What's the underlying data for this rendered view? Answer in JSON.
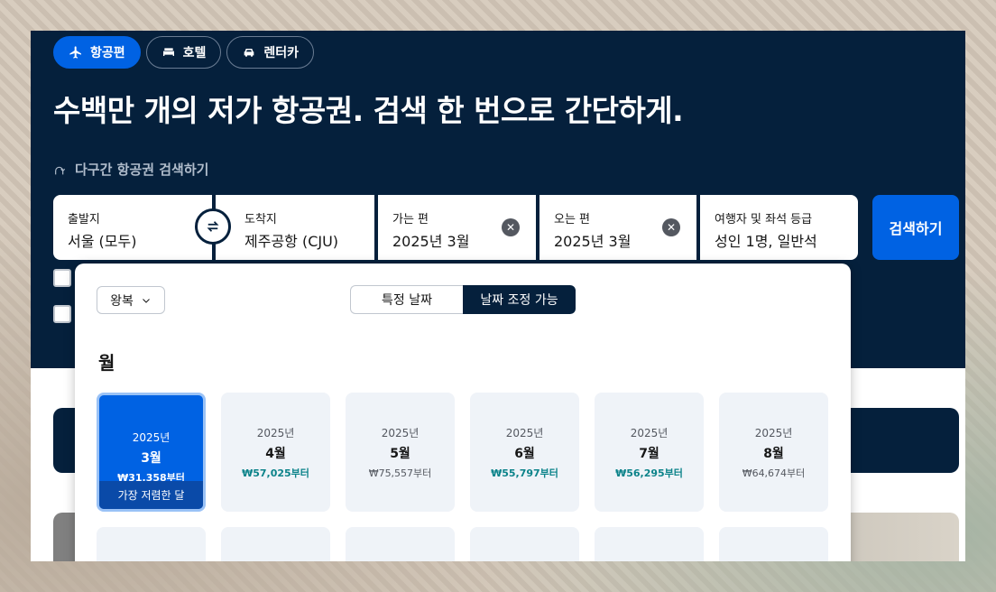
{
  "tabs": [
    {
      "label": "항공편",
      "icon": "plane-icon",
      "active": true
    },
    {
      "label": "호텔",
      "icon": "bed-icon",
      "active": false
    },
    {
      "label": "렌터카",
      "icon": "car-icon",
      "active": false
    }
  ],
  "headline": "수백만 개의 저가 항공권. 검색 한 번으로 간단하게.",
  "multi_city_link": "다구간 항공권 검색하기",
  "search": {
    "origin": {
      "label": "출발지",
      "value": "서울 (모두)"
    },
    "destination": {
      "label": "도착지",
      "value": "제주공항 (CJU)"
    },
    "depart": {
      "label": "가는 편",
      "value": "2025년 3월"
    },
    "return": {
      "label": "오는 편",
      "value": "2025년 3월"
    },
    "travellers": {
      "label": "여행자 및 좌석 등급",
      "value": "성인 1명, 일반석"
    },
    "search_button": "검색하기"
  },
  "calendar_popup": {
    "trip_type": "왕복",
    "date_mode": [
      "특정 날짜",
      "날짜 조정 가능"
    ],
    "section_title": "월",
    "months": [
      {
        "year": "2025년",
        "month": "3월",
        "price": "₩31,358부터",
        "cheap": true,
        "selected": true,
        "badge": "가장 저렴한 달"
      },
      {
        "year": "2025년",
        "month": "4월",
        "price": "₩57,025부터",
        "cheap": true,
        "selected": false
      },
      {
        "year": "2025년",
        "month": "5월",
        "price": "₩75,557부터",
        "cheap": false,
        "selected": false
      },
      {
        "year": "2025년",
        "month": "6월",
        "price": "₩55,797부터",
        "cheap": true,
        "selected": false
      },
      {
        "year": "2025년",
        "month": "7월",
        "price": "₩56,295부터",
        "cheap": true,
        "selected": false
      },
      {
        "year": "2025년",
        "month": "8월",
        "price": "₩64,674부터",
        "cheap": false,
        "selected": false
      }
    ]
  },
  "colors": {
    "navy": "#05203c",
    "brand_blue": "#0062e3",
    "cheap_teal": "#0c838a"
  }
}
